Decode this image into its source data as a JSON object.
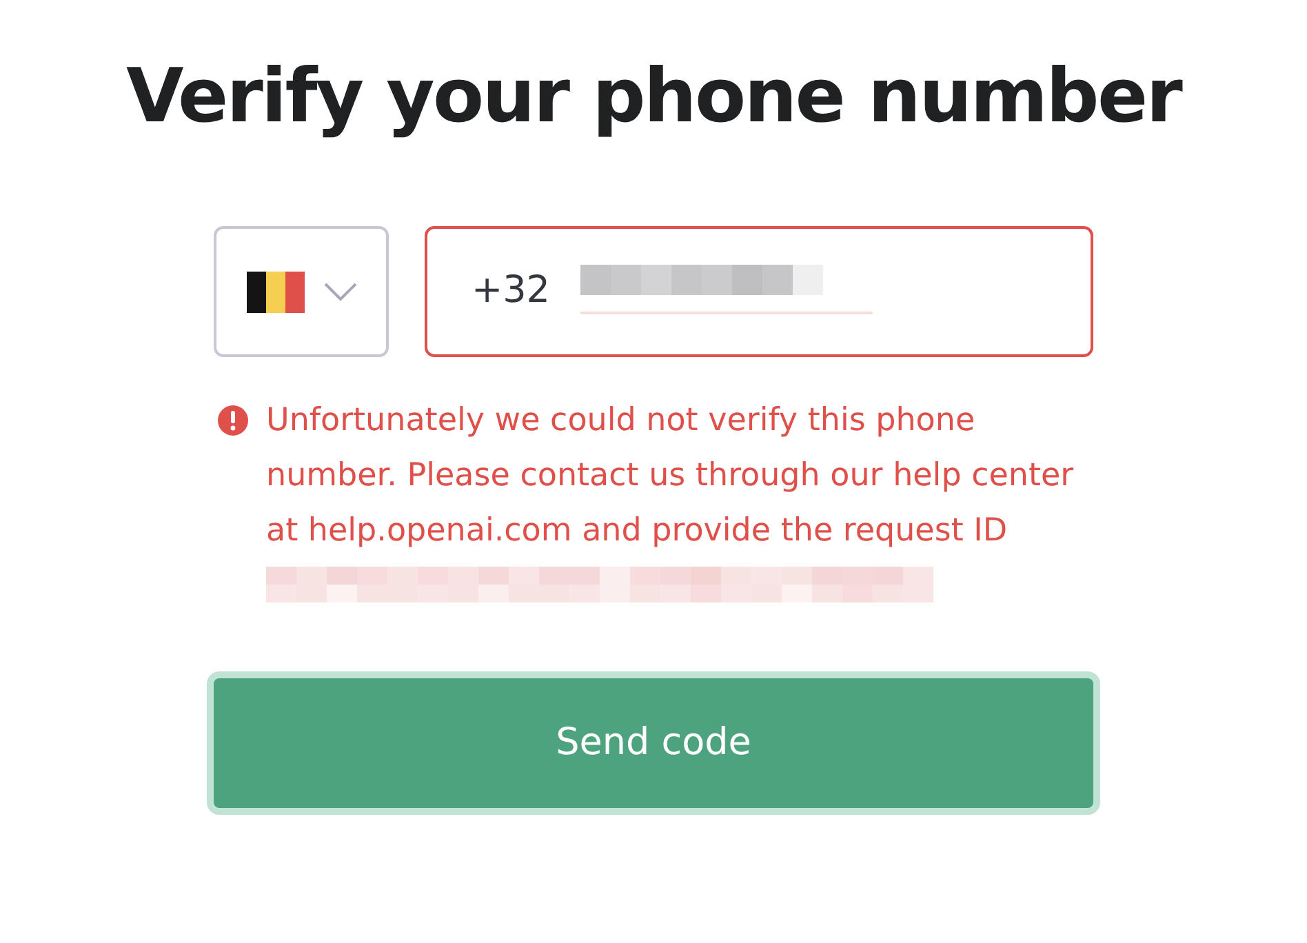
{
  "title": "Verify your phone number",
  "phone": {
    "country_code": "+32",
    "error": true
  },
  "error_message": "Unfortunately we could not verify this phone number. Please contact us through our help center at help.openai.com and provide the request ID",
  "button": {
    "label": "Send code"
  }
}
